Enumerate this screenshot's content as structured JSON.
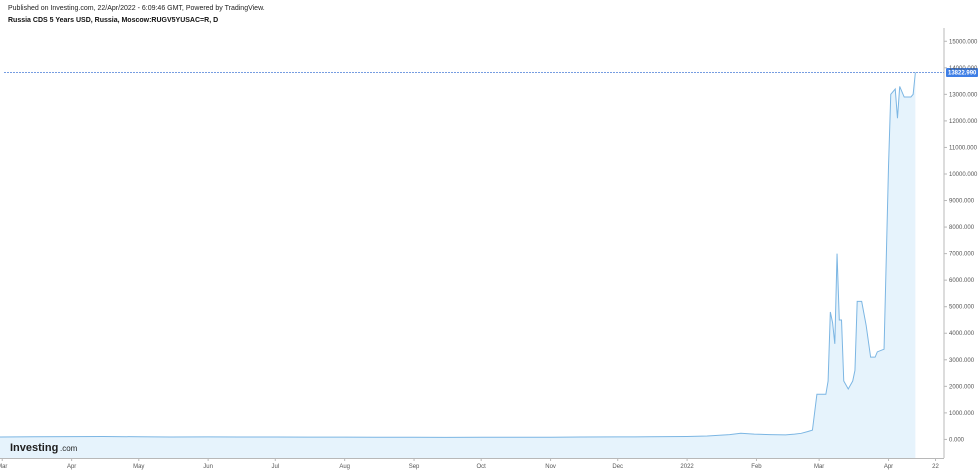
{
  "header": {
    "published": "Published on Investing.com, 22/Apr/2022 - 6:09:46 GMT, Powered by TradingView.",
    "symbol": "Russia CDS 5 Years USD, Russia, Moscow:RUGV5YUSAC=R, D"
  },
  "logo": {
    "brand": "Investing",
    "suffix": ".com"
  },
  "colors": {
    "line": "#7cb6e3",
    "area": "#e6f3fc",
    "price_line": "#4a7ed8",
    "price_label_bg": "#3d7ee6",
    "axis": "#b8b8b8"
  },
  "chart_data": {
    "type": "area",
    "ylim": [
      -700,
      15500
    ],
    "yticks": [
      0,
      1000,
      2000,
      3000,
      4000,
      5000,
      6000,
      7000,
      8000,
      9000,
      10000,
      11000,
      12000,
      13000,
      14000,
      15000
    ],
    "ytick_labels": [
      "0.000",
      "1000.000",
      "2000.000",
      "3000.000",
      "4000.000",
      "5000.000",
      "6000.000",
      "7000.000",
      "8000.000",
      "9000.000",
      "10000.000",
      "11000.000",
      "12000.000",
      "13000.000",
      "14000.000",
      "15000.000"
    ],
    "xlim": [
      "2021-02-28",
      "2022-04-24"
    ],
    "xticks": [
      {
        "date": "2021-03-01",
        "label": "Mar"
      },
      {
        "date": "2021-04-01",
        "label": "Apr"
      },
      {
        "date": "2021-05-01",
        "label": "May"
      },
      {
        "date": "2021-06-01",
        "label": "Jun"
      },
      {
        "date": "2021-07-01",
        "label": "Jul"
      },
      {
        "date": "2021-08-01",
        "label": "Aug"
      },
      {
        "date": "2021-09-01",
        "label": "Sep"
      },
      {
        "date": "2021-10-01",
        "label": "Oct"
      },
      {
        "date": "2021-11-01",
        "label": "Nov"
      },
      {
        "date": "2021-12-01",
        "label": "Dec"
      },
      {
        "date": "2022-01-01",
        "label": "2022"
      },
      {
        "date": "2022-02-01",
        "label": "Feb"
      },
      {
        "date": "2022-03-01",
        "label": "Mar"
      },
      {
        "date": "2022-04-01",
        "label": "Apr"
      },
      {
        "date": "2022-04-22",
        "label": "22"
      }
    ],
    "last_value": 13822.99,
    "last_value_label": "13822.990",
    "series": [
      {
        "points": [
          [
            "2021-02-28",
            90
          ],
          [
            "2021-03-15",
            100
          ],
          [
            "2021-04-01",
            105
          ],
          [
            "2021-04-15",
            110
          ],
          [
            "2021-05-01",
            100
          ],
          [
            "2021-05-15",
            90
          ],
          [
            "2021-06-01",
            95
          ],
          [
            "2021-06-15",
            90
          ],
          [
            "2021-07-01",
            90
          ],
          [
            "2021-07-15",
            85
          ],
          [
            "2021-08-01",
            85
          ],
          [
            "2021-08-15",
            80
          ],
          [
            "2021-09-01",
            80
          ],
          [
            "2021-09-15",
            75
          ],
          [
            "2021-10-01",
            80
          ],
          [
            "2021-10-15",
            80
          ],
          [
            "2021-11-01",
            80
          ],
          [
            "2021-11-15",
            90
          ],
          [
            "2021-12-01",
            95
          ],
          [
            "2021-12-15",
            100
          ],
          [
            "2022-01-01",
            110
          ],
          [
            "2022-01-10",
            130
          ],
          [
            "2022-01-20",
            180
          ],
          [
            "2022-01-25",
            230
          ],
          [
            "2022-01-31",
            200
          ],
          [
            "2022-02-07",
            180
          ],
          [
            "2022-02-14",
            170
          ],
          [
            "2022-02-18",
            200
          ],
          [
            "2022-02-21",
            230
          ],
          [
            "2022-02-24",
            300
          ],
          [
            "2022-02-26",
            350
          ],
          [
            "2022-02-28",
            1700
          ],
          [
            "2022-03-02",
            1700
          ],
          [
            "2022-03-04",
            1700
          ],
          [
            "2022-03-05",
            2200
          ],
          [
            "2022-03-06",
            4800
          ],
          [
            "2022-03-07",
            4400
          ],
          [
            "2022-03-08",
            3600
          ],
          [
            "2022-03-09",
            7000
          ],
          [
            "2022-03-10",
            4500
          ],
          [
            "2022-03-11",
            4500
          ],
          [
            "2022-03-12",
            2200
          ],
          [
            "2022-03-14",
            1900
          ],
          [
            "2022-03-16",
            2200
          ],
          [
            "2022-03-17",
            2600
          ],
          [
            "2022-03-18",
            5200
          ],
          [
            "2022-03-20",
            5200
          ],
          [
            "2022-03-22",
            4300
          ],
          [
            "2022-03-24",
            3100
          ],
          [
            "2022-03-26",
            3100
          ],
          [
            "2022-03-27",
            3300
          ],
          [
            "2022-03-30",
            3400
          ],
          [
            "2022-04-01",
            10300
          ],
          [
            "2022-04-02",
            13000
          ],
          [
            "2022-04-04",
            13200
          ],
          [
            "2022-04-05",
            12100
          ],
          [
            "2022-04-06",
            13300
          ],
          [
            "2022-04-08",
            12900
          ],
          [
            "2022-04-11",
            12900
          ],
          [
            "2022-04-12",
            13000
          ],
          [
            "2022-04-13",
            13822.99
          ]
        ]
      }
    ]
  }
}
